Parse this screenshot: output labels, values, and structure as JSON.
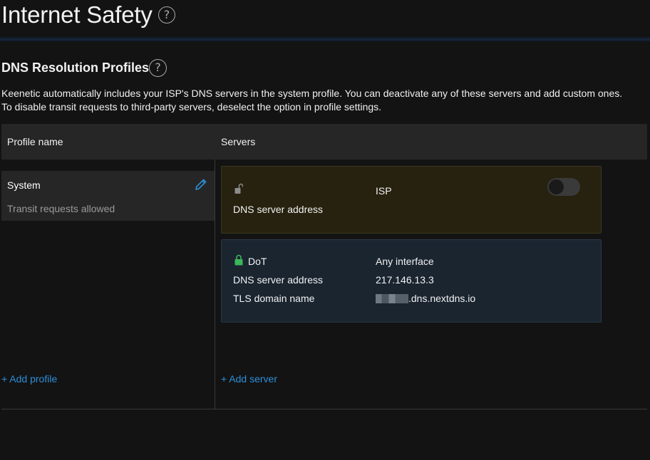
{
  "page": {
    "title": "Internet Safety",
    "help_glyph": "?"
  },
  "section": {
    "title": "DNS Resolution Profiles",
    "help_glyph": "?",
    "description_line1": "Keenetic automatically includes your ISP's DNS servers in the system profile. You can deactivate any of these servers and add custom ones.",
    "description_line2": "To disable transit requests to third-party servers, deselect the option in profile settings."
  },
  "table": {
    "col_profile": "Profile name",
    "col_servers": "Servers"
  },
  "profiles": [
    {
      "name": "System",
      "status": "Transit requests allowed",
      "edit_icon": "pencil-icon"
    }
  ],
  "servers": [
    {
      "icon": "lock-open-icon",
      "label": "",
      "type_value": "ISP",
      "address_label": "DNS server address",
      "enabled": false,
      "card_color": "#26220f"
    },
    {
      "icon": "lock-closed-icon",
      "label": "DoT",
      "interface_value": "Any interface",
      "address_label": "DNS server address",
      "address_value": "217.146.13.3",
      "tls_label": "TLS domain name",
      "tls_value_suffix": ".dns.nextdns.io",
      "card_color": "#1a2530"
    }
  ],
  "actions": {
    "add_profile": "+ Add profile",
    "add_server": "+ Add server"
  },
  "colors": {
    "accent": "#2d8fd8",
    "lock_green": "#3cb65a",
    "background": "#131313"
  }
}
